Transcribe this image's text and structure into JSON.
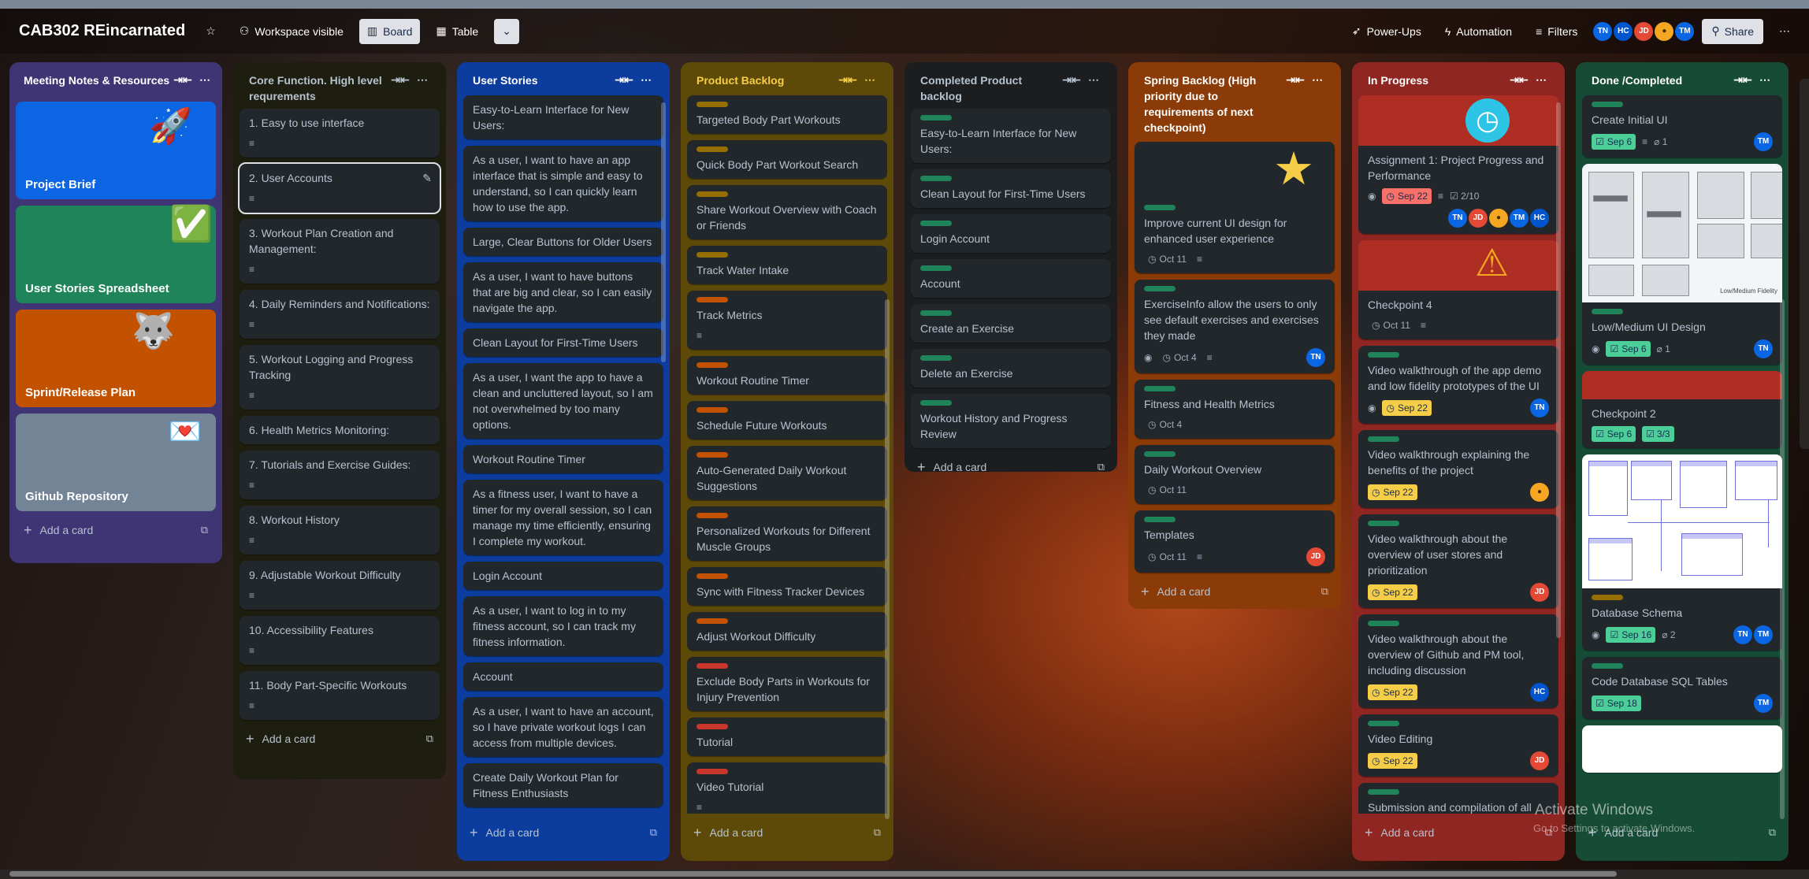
{
  "board": {
    "title": "CAB302 REincarnated",
    "visibility": "Workspace visible",
    "views": [
      "Board",
      "Table"
    ],
    "power_ups": "Power-Ups",
    "automation": "Automation",
    "filters": "Filters",
    "share": "Share",
    "members": [
      "TN",
      "HC",
      "JD",
      "",
      "TM"
    ]
  },
  "colors": {
    "list1": "#3f3574",
    "list2": "#1e1e10",
    "list3": "#0b3c9e",
    "list4": "#5e4a08",
    "list5": "#1b1d1e",
    "list6": "#8a3b07",
    "list7": "#8f2622",
    "list8": "#164b35"
  },
  "lists": {
    "meeting": {
      "title": "Meeting Notes & Resources",
      "tiles": [
        "Project Brief",
        "User Stories Spreadsheet",
        "Sprint/Release Plan",
        "Github Repository"
      ],
      "add": "Add a card"
    },
    "core": {
      "title": "Core Function. High level requrements",
      "cards": [
        "1. Easy to use interface",
        "2. User Accounts",
        "3. Workout Plan Creation and Management:",
        "4. Daily Reminders and Notifications:",
        "5. Workout Logging and Progress Tracking",
        "6. Health Metrics Monitoring:",
        "7. Tutorials and Exercise Guides:",
        "8. Workout History",
        "9. Adjustable Workout Difficulty",
        "10. Accessibility Features",
        "11. Body Part-Specific Workouts"
      ],
      "add": "Add a card"
    },
    "stories": {
      "title": "User Stories",
      "cards": [
        "Easy-to-Learn Interface for New Users:",
        "As a user, I want to have an app interface that is simple and easy to understand, so I can quickly learn how to use the app.",
        "Large, Clear Buttons for Older Users",
        "As a user, I want to have buttons that are big and clear, so I can easily navigate the app.",
        "Clean Layout for First-Time Users",
        "As a user, I want the app to have a clean and uncluttered layout, so I am not overwhelmed by too many options.",
        "Workout Routine Timer",
        "As a fitness user, I want to have a timer for my overall session, so I can manage my time efficiently, ensuring I complete my workout.",
        "Login Account",
        "As a user, I want to log in to my fitness account, so I can track my fitness information.",
        "Account",
        "As a user, I want to have an account, so I have private workout logs I can access from multiple devices.",
        "Create Daily Workout Plan for Fitness Enthusiasts"
      ],
      "add": "Add a card"
    },
    "backlog": {
      "title": "Product Backlog",
      "cards": [
        "Targeted Body Part Workouts",
        "Quick Body Part Workout Search",
        "Share Workout Overview with Coach or Friends",
        "Track Water Intake",
        "Track Metrics",
        "Workout Routine Timer",
        "Schedule Future Workouts",
        "Auto-Generated Daily Workout Suggestions",
        "Personalized Workouts for Different Muscle Groups",
        "Sync with Fitness Tracker Devices",
        "Adjust Workout Difficulty",
        "Exclude Body Parts in Workouts for Injury Prevention",
        "Tutorial",
        "Video Tutorial"
      ],
      "add": "Add a card"
    },
    "completed": {
      "title": "Completed Product backlog",
      "cards": [
        "Easy-to-Learn Interface for New Users:",
        "Clean Layout for First-Time Users",
        "Login Account",
        "Account",
        "Create an Exercise",
        "Delete an Exercise",
        "Workout History and Progress Review"
      ],
      "add": "Add a card"
    },
    "sprint": {
      "title": "Spring Backlog (High priority due to requirements of next checkpoint)",
      "cards": [
        {
          "title": "Improve current UI design for enhanced user experience",
          "date": "Oct 11"
        },
        {
          "title": "ExerciseInfo allow the users to only see default exercises and exercises they made",
          "date": "Oct 4",
          "member": "TN"
        },
        {
          "title": "Fitness and Health Metrics",
          "date": "Oct 4"
        },
        {
          "title": "Daily Workout Overview",
          "date": "Oct 11"
        },
        {
          "title": "Templates",
          "date": "Oct 11",
          "member": "JD"
        }
      ],
      "add": "Add a card"
    },
    "progress": {
      "title": "In Progress",
      "cards": [
        {
          "title": "Assignment 1: Project Progress and Performance",
          "date": "Sep 22",
          "check": "2/10",
          "members": [
            "TN",
            "JD",
            "",
            "TM",
            "HC"
          ]
        },
        {
          "title": "Checkpoint 4",
          "date": "Oct 11"
        },
        {
          "title": "Video walkthrough of the app demo and low fidelity prototypes of the UI",
          "date": "Sep 22",
          "member": "TN"
        },
        {
          "title": "Video walkthrough explaining the benefits of the project",
          "date": "Sep 22",
          "member": ""
        },
        {
          "title": "Video walkthrough about the overview of user stores and prioritization",
          "date": "Sep 22",
          "member": "JD"
        },
        {
          "title": "Video walkthrough about the overview of Github and PM tool, including discussion",
          "date": "Sep 22",
          "member": "HC"
        },
        {
          "title": "Video Editing",
          "date": "Sep 22",
          "member": "JD"
        },
        {
          "title": "Submission and compilation of all"
        }
      ],
      "add": "Add a card"
    },
    "done": {
      "title": "Done /Completed",
      "cards": [
        {
          "title": "Create Initial UI",
          "date": "Sep 6",
          "attach": "1",
          "member": "TM"
        },
        {
          "title": "Low/Medium UI Design",
          "date": "Sep 6",
          "attach": "1",
          "member": "TN",
          "cover_caption": "Low/Medium Fidelity"
        },
        {
          "title": "Checkpoint 2",
          "date": "Sep 6",
          "check": "3/3"
        },
        {
          "title": "Database Schema",
          "date": "Sep 16",
          "attach": "2",
          "members": [
            "TN",
            "TM"
          ]
        },
        {
          "title": "Code Database SQL Tables",
          "date": "Sep 18",
          "member": "TM"
        }
      ],
      "add": "Add a card"
    }
  },
  "overlay": {
    "line1": "Activate Windows",
    "line2": "Go to Settings to activate Windows."
  }
}
